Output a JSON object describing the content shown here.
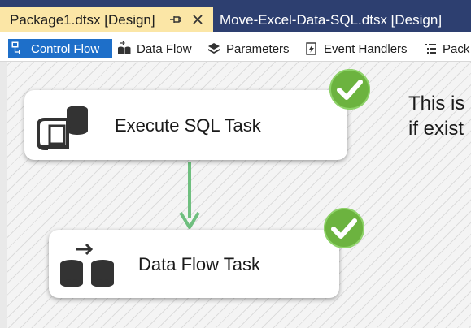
{
  "document_tabs": {
    "active": {
      "label": "Package1.dtsx [Design]"
    },
    "inactive": {
      "label": "Move-Excel-Data-SQL.dtsx [Design]"
    }
  },
  "designer_tabs": {
    "control_flow": "Control Flow",
    "data_flow": "Data Flow",
    "parameters": "Parameters",
    "event_handlers": "Event Handlers",
    "package_explorer": "Pack"
  },
  "tasks": {
    "execute_sql": {
      "label": "Execute SQL Task",
      "status": "success"
    },
    "data_flow": {
      "label": "Data Flow Task",
      "status": "success"
    }
  },
  "annotation": {
    "line1": "This is",
    "line2": "if exist"
  },
  "colors": {
    "doc_tab_bar": "#2d3f70",
    "active_doc_tab": "#fbe6a6",
    "selected_designer_tab": "#1e6fc9",
    "precedence_success": "#6fbf7f",
    "status_success": "#6cb33f"
  },
  "icons": {
    "pin": "pin-icon",
    "close": "close-icon",
    "control_flow": "control-flow-icon",
    "data_flow": "data-flow-icon",
    "parameters": "parameters-icon",
    "event_handlers": "event-handlers-icon",
    "package_explorer": "package-explorer-icon",
    "execute_sql": "execute-sql-task-icon",
    "data_flow_task": "data-flow-task-icon",
    "check": "check-icon"
  }
}
